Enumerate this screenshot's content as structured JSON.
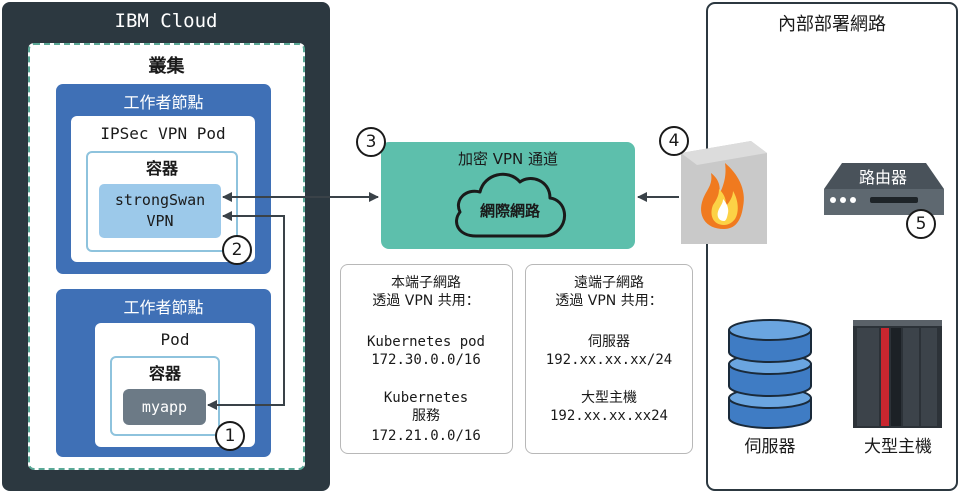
{
  "ibm_cloud": {
    "title": "IBM Cloud",
    "cluster_label": "叢集",
    "worker_node_1": {
      "label": "工作者節點",
      "pod_label": "IPSec VPN Pod",
      "container_label": "容器",
      "app_line1": "strongSwan",
      "app_line2": "VPN"
    },
    "worker_node_2": {
      "label": "工作者節點",
      "pod_label": "Pod",
      "container_label": "容器",
      "app": "myapp"
    }
  },
  "steps": [
    "1",
    "2",
    "3",
    "4",
    "5"
  ],
  "vpn": {
    "title": "加密 VPN 通道",
    "internet_label": "網際網路"
  },
  "local_subnets": {
    "heading_line1": "本端子網路",
    "heading_line2": "透過 VPN 共用：",
    "pod_label": "Kubernetes pod",
    "pod_cidr": "172.30.0.0/16",
    "service_label_line1": "Kubernetes",
    "service_label_line2": "服務",
    "service_cidr": "172.21.0.0/16"
  },
  "remote_subnets": {
    "heading_line1": "遠端子網路",
    "heading_line2": "透過 VPN 共用：",
    "server_label": "伺服器",
    "server_cidr": "192.xx.xx.xx/24",
    "mainframe_label": "大型主機",
    "mainframe_cidr": "192.xx.xx.xx24"
  },
  "on_prem": {
    "title": "內部部署網路",
    "router_label": "路由器",
    "server_label": "伺服器",
    "mainframe_label": "大型主機"
  },
  "icons": {
    "firewall": "firewall-icon",
    "router": "router-icon",
    "server": "server-database-icon",
    "mainframe": "mainframe-icon",
    "internet": "cloud-icon"
  },
  "colors": {
    "ibm_cloud_bg": "#2c3840",
    "cluster_border": "#5aa896",
    "worker_node": "#3f70b6",
    "container_border": "#8ec3dd",
    "strongswan_bg": "#9cc9ea",
    "myapp_bg": "#6c7a86",
    "vpn_tunnel": "#5dbfac",
    "server_blue": "#3f7cc4",
    "mainframe_red": "#c9262f"
  }
}
